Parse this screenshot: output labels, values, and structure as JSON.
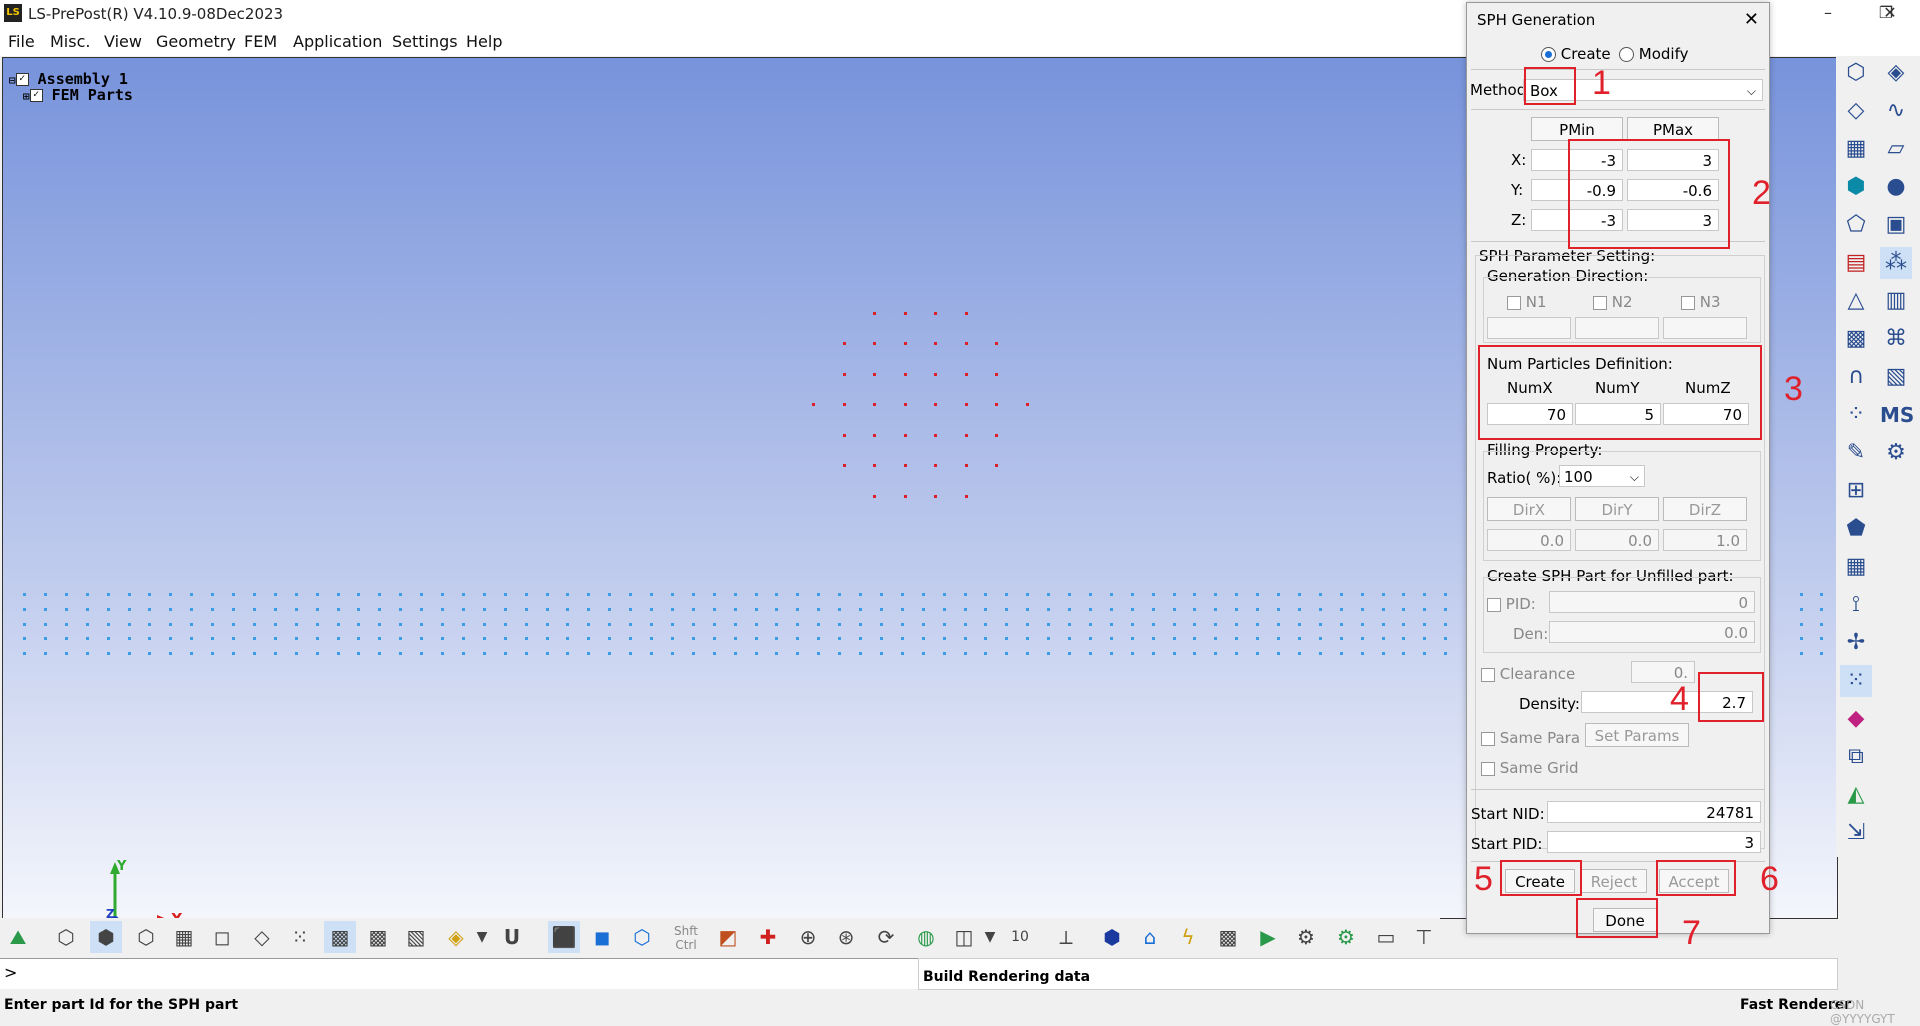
{
  "app": {
    "title": "LS-PrePost(R) V4.10.9-08Dec2023",
    "icon_text": "LS",
    "window_controls": {
      "minimize": "–",
      "maximize": "❐",
      "close": "✕"
    }
  },
  "menu": [
    "File",
    "Misc.",
    "View",
    "Geometry",
    "FEM",
    "Application",
    "Settings",
    "Help"
  ],
  "tree": {
    "assembly": "Assembly 1",
    "fem_parts": "FEM Parts"
  },
  "dialog": {
    "title": "SPH Generation",
    "close": "✕",
    "mode_create": "Create",
    "mode_modify": "Modify",
    "method_label": "Method",
    "method_value": "Box",
    "pmin_label": "PMin",
    "pmax_label": "PMax",
    "x_label": "X:",
    "y_label": "Y:",
    "z_label": "Z:",
    "x_min": "-3",
    "x_max": "3",
    "y_min": "-0.9",
    "y_max": "-0.6",
    "z_min": "-3",
    "z_max": "3",
    "sph_param_label": "SPH Parameter Setting:",
    "gen_dir_label": "Generation Direction:",
    "n1": "N1",
    "n2": "N2",
    "n3": "N3",
    "num_particles_label": "Num Particles Definition:",
    "numx_label": "NumX",
    "numy_label": "NumY",
    "numz_label": "NumZ",
    "numx": "70",
    "numy": "5",
    "numz": "70",
    "filling_label": "Filling Property:",
    "ratio_label": "Ratio( %):",
    "ratio_value": "100",
    "dirx_label": "DirX",
    "diry_label": "DirY",
    "dirz_label": "DirZ",
    "dirx": "0.0",
    "diry": "0.0",
    "dirz": "1.0",
    "unfilled_label": "Create SPH Part for Unfilled part:",
    "pid_label": "PID:",
    "pid_value": "0",
    "den_label": "Den:",
    "den_value": "0.0",
    "clearance_label": "Clearance",
    "clearance_value": "0.",
    "density_label": "Density:",
    "density_value": "2.7",
    "same_para_label": "Same Para",
    "set_params_label": "Set Params",
    "same_grid_label": "Same Grid",
    "start_nid_label": "Start NID:",
    "start_nid": "24781",
    "start_pid_label": "Start PID:",
    "start_pid": "3",
    "create_btn": "Create",
    "reject_btn": "Reject",
    "accept_btn": "Accept",
    "done_btn": "Done"
  },
  "annotations": [
    "1",
    "2",
    "3",
    "4",
    "5",
    "6",
    "7"
  ],
  "axis": {
    "x": "X",
    "y": "Y",
    "z": "Z"
  },
  "toolbar": {
    "shft": "Shft",
    "ctrl": "Ctrl",
    "num": "10",
    "u": "U"
  },
  "cmd_prompt": ">",
  "message": "Build Rendering data",
  "status_left": "Enter part Id for the SPH part",
  "status_right": "Fast Renderer",
  "watermark": "CSDN @YYYYGYT",
  "colors": {
    "annotation": "#e0202a",
    "particles_red": "#dd1f2a",
    "particles_blue": "#3a9de6",
    "viewport_top": "#7793db"
  }
}
